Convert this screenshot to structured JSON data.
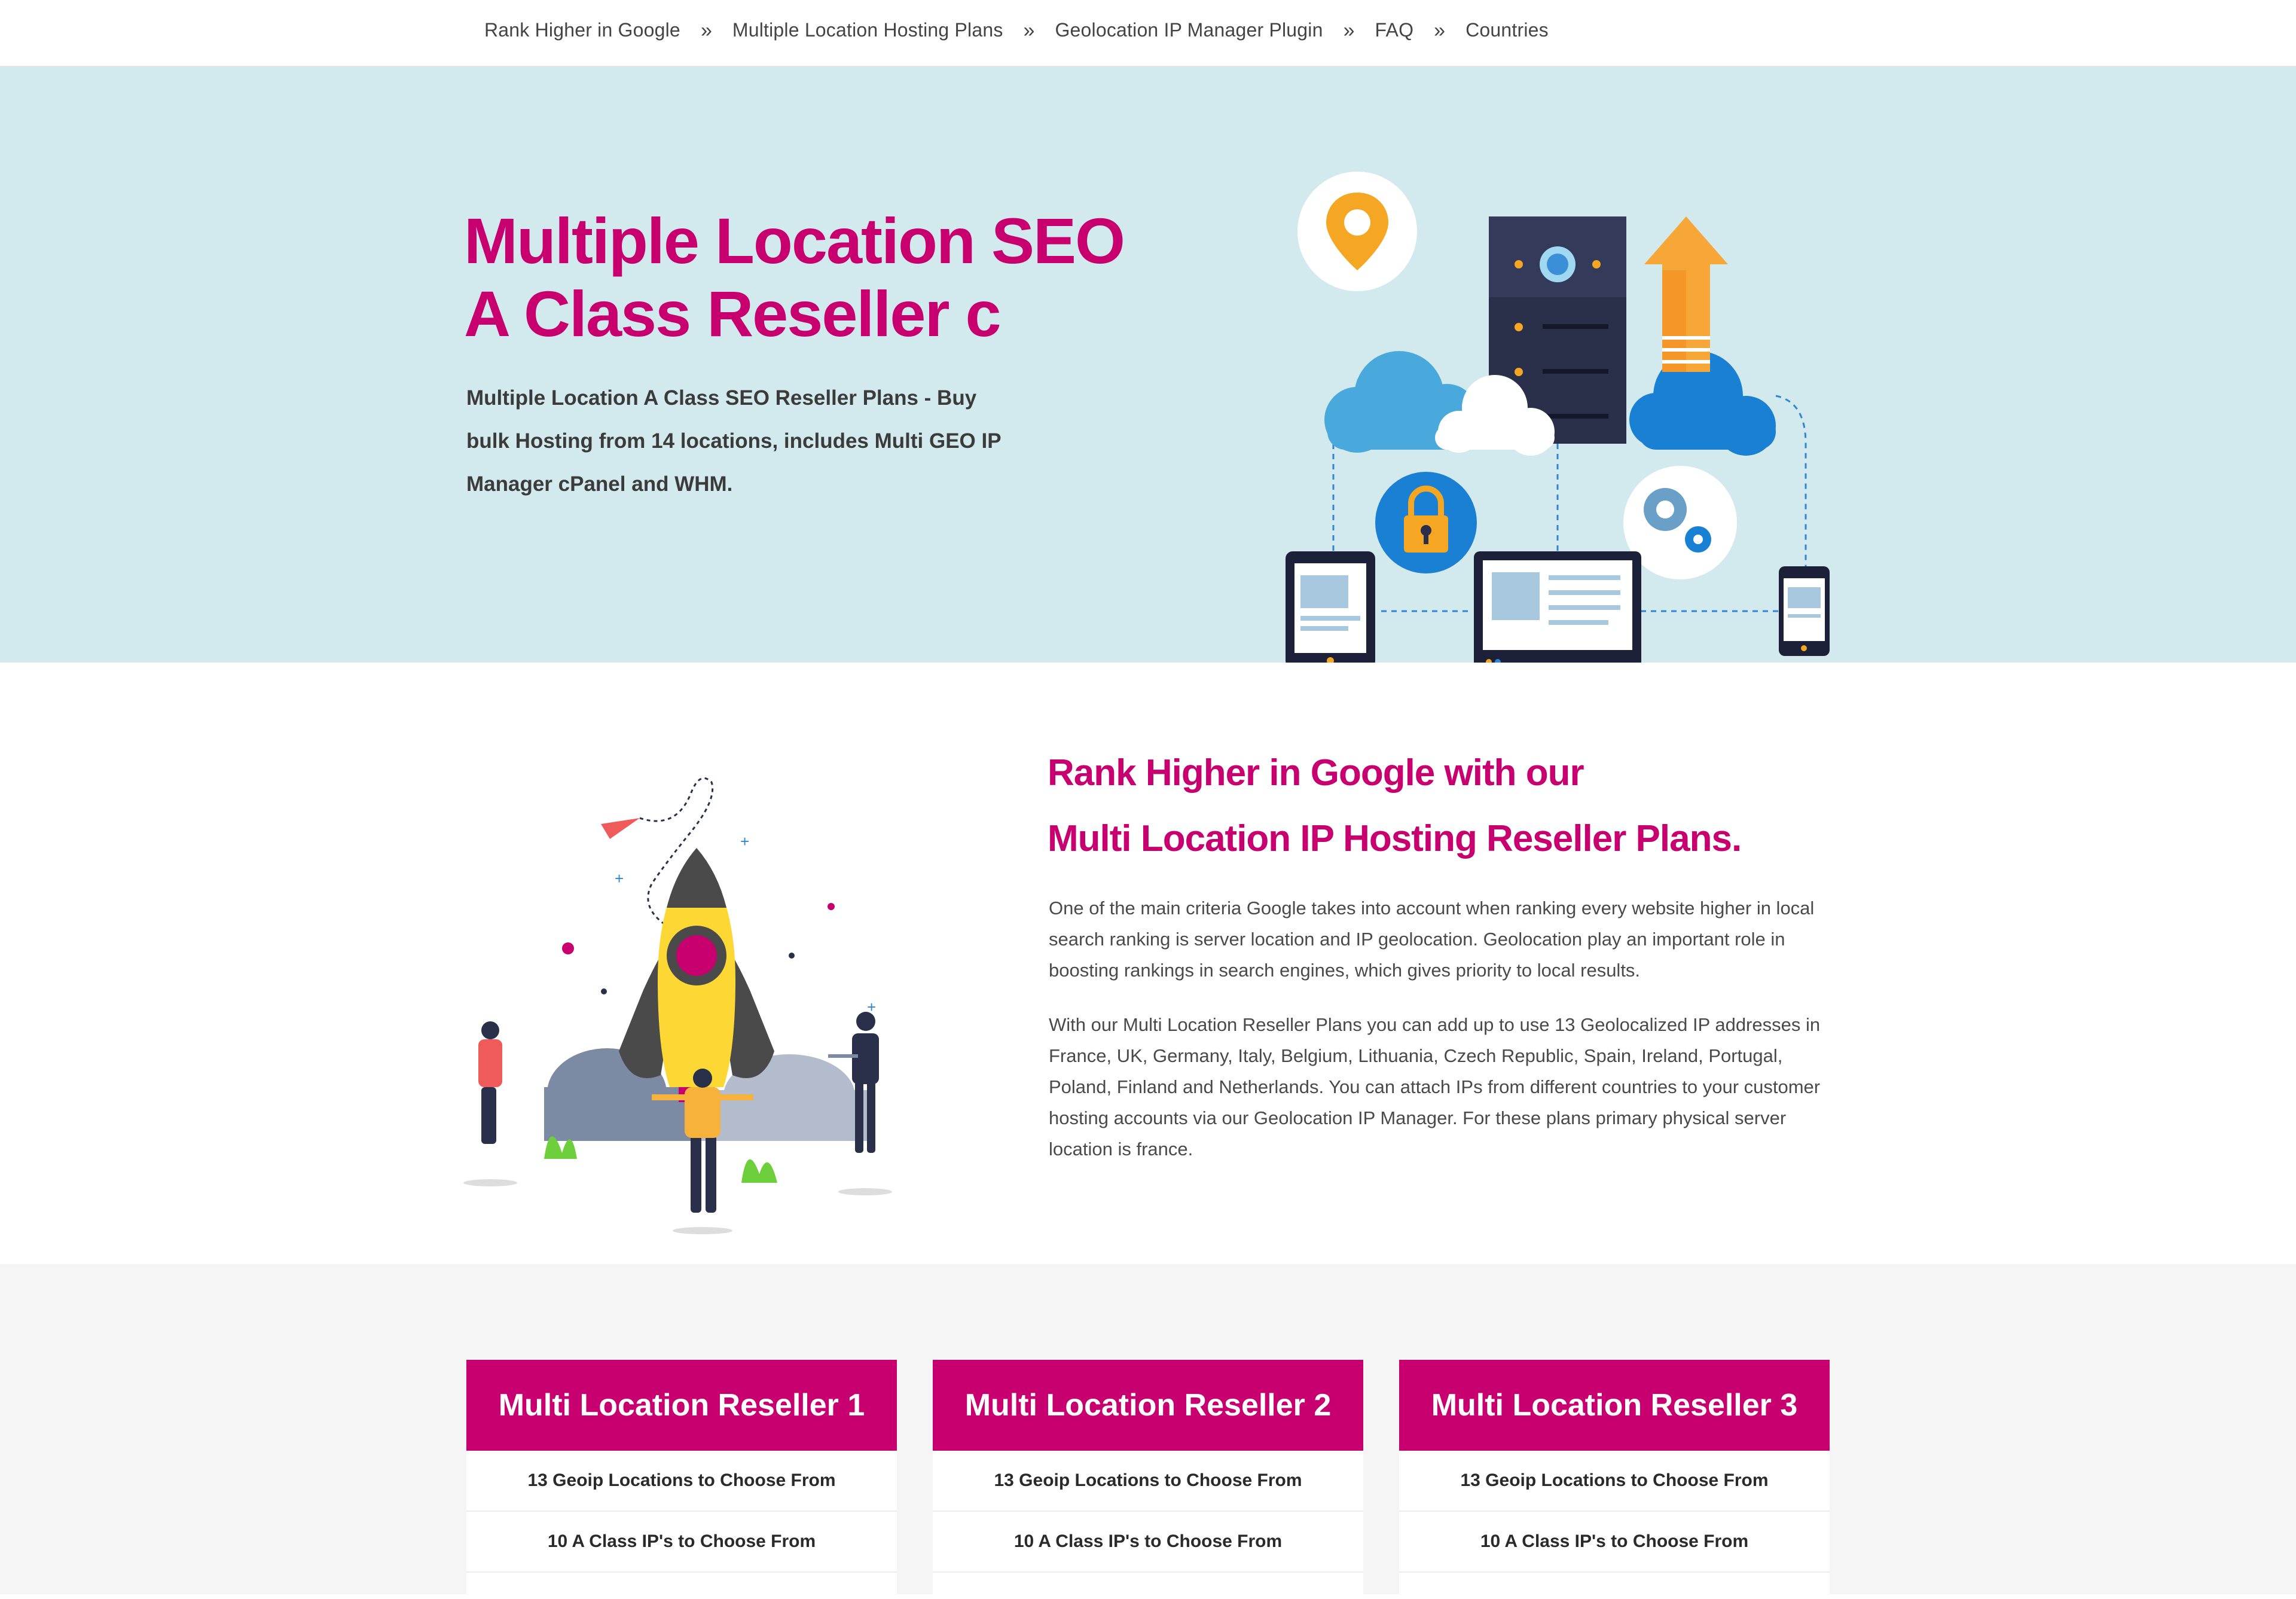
{
  "nav": {
    "items": [
      {
        "label": "Rank Higher in Google"
      },
      {
        "label": "Multiple Location Hosting Plans"
      },
      {
        "label": "Geolocation IP Manager Plugin"
      },
      {
        "label": "FAQ"
      },
      {
        "label": "Countries"
      }
    ],
    "separator_icon": "double-chevron-right-icon"
  },
  "hero": {
    "title_line1": "Multiple Location SEO",
    "title_line2": "A Class Reseller c",
    "description": "Multiple Location A Class SEO Reseller Plans - Buy bulk Hosting from 14 locations, includes Multi GEO IP Manager cPanel and WHM.",
    "illustration": "cloud-server-network-illustration"
  },
  "section2": {
    "heading_line1": "Rank Higher in Google with our",
    "heading_line2": "Multi Location IP Hosting Reseller Plans.",
    "paragraph1": "One of the main criteria Google takes into account when ranking every website higher in local search ranking is server location and IP geolocation. Geolocation play an important role in boosting rankings in search engines, which gives priority to local results.",
    "paragraph2": "With our Multi Location Reseller Plans you can add up to use 13 Geolocalized IP addresses in France, UK, Germany, Italy, Belgium, Lithuania, Czech Republic, Spain, Ireland, Portugal, Poland, Finland and Netherlands. You can attach IPs from different countries to your customer hosting accounts via our Geolocation IP Manager. For these plans primary physical server location is france.",
    "illustration": "rocket-launch-illustration"
  },
  "plans": [
    {
      "title": "Multi Location Reseller 1",
      "features": [
        "13 Geoip Locations to Choose From",
        "10 A Class IP's to Choose From"
      ]
    },
    {
      "title": "Multi Location Reseller 2",
      "features": [
        "13 Geoip Locations to Choose From",
        "10 A Class IP's to Choose From"
      ]
    },
    {
      "title": "Multi Location Reseller 3",
      "features": [
        "13 Geoip Locations to Choose From",
        "10 A Class IP's to Choose From"
      ]
    }
  ],
  "colors": {
    "brand": "#c8006f",
    "hero_bg": "#d2e9ee",
    "plans_bg": "#f5f5f5"
  }
}
